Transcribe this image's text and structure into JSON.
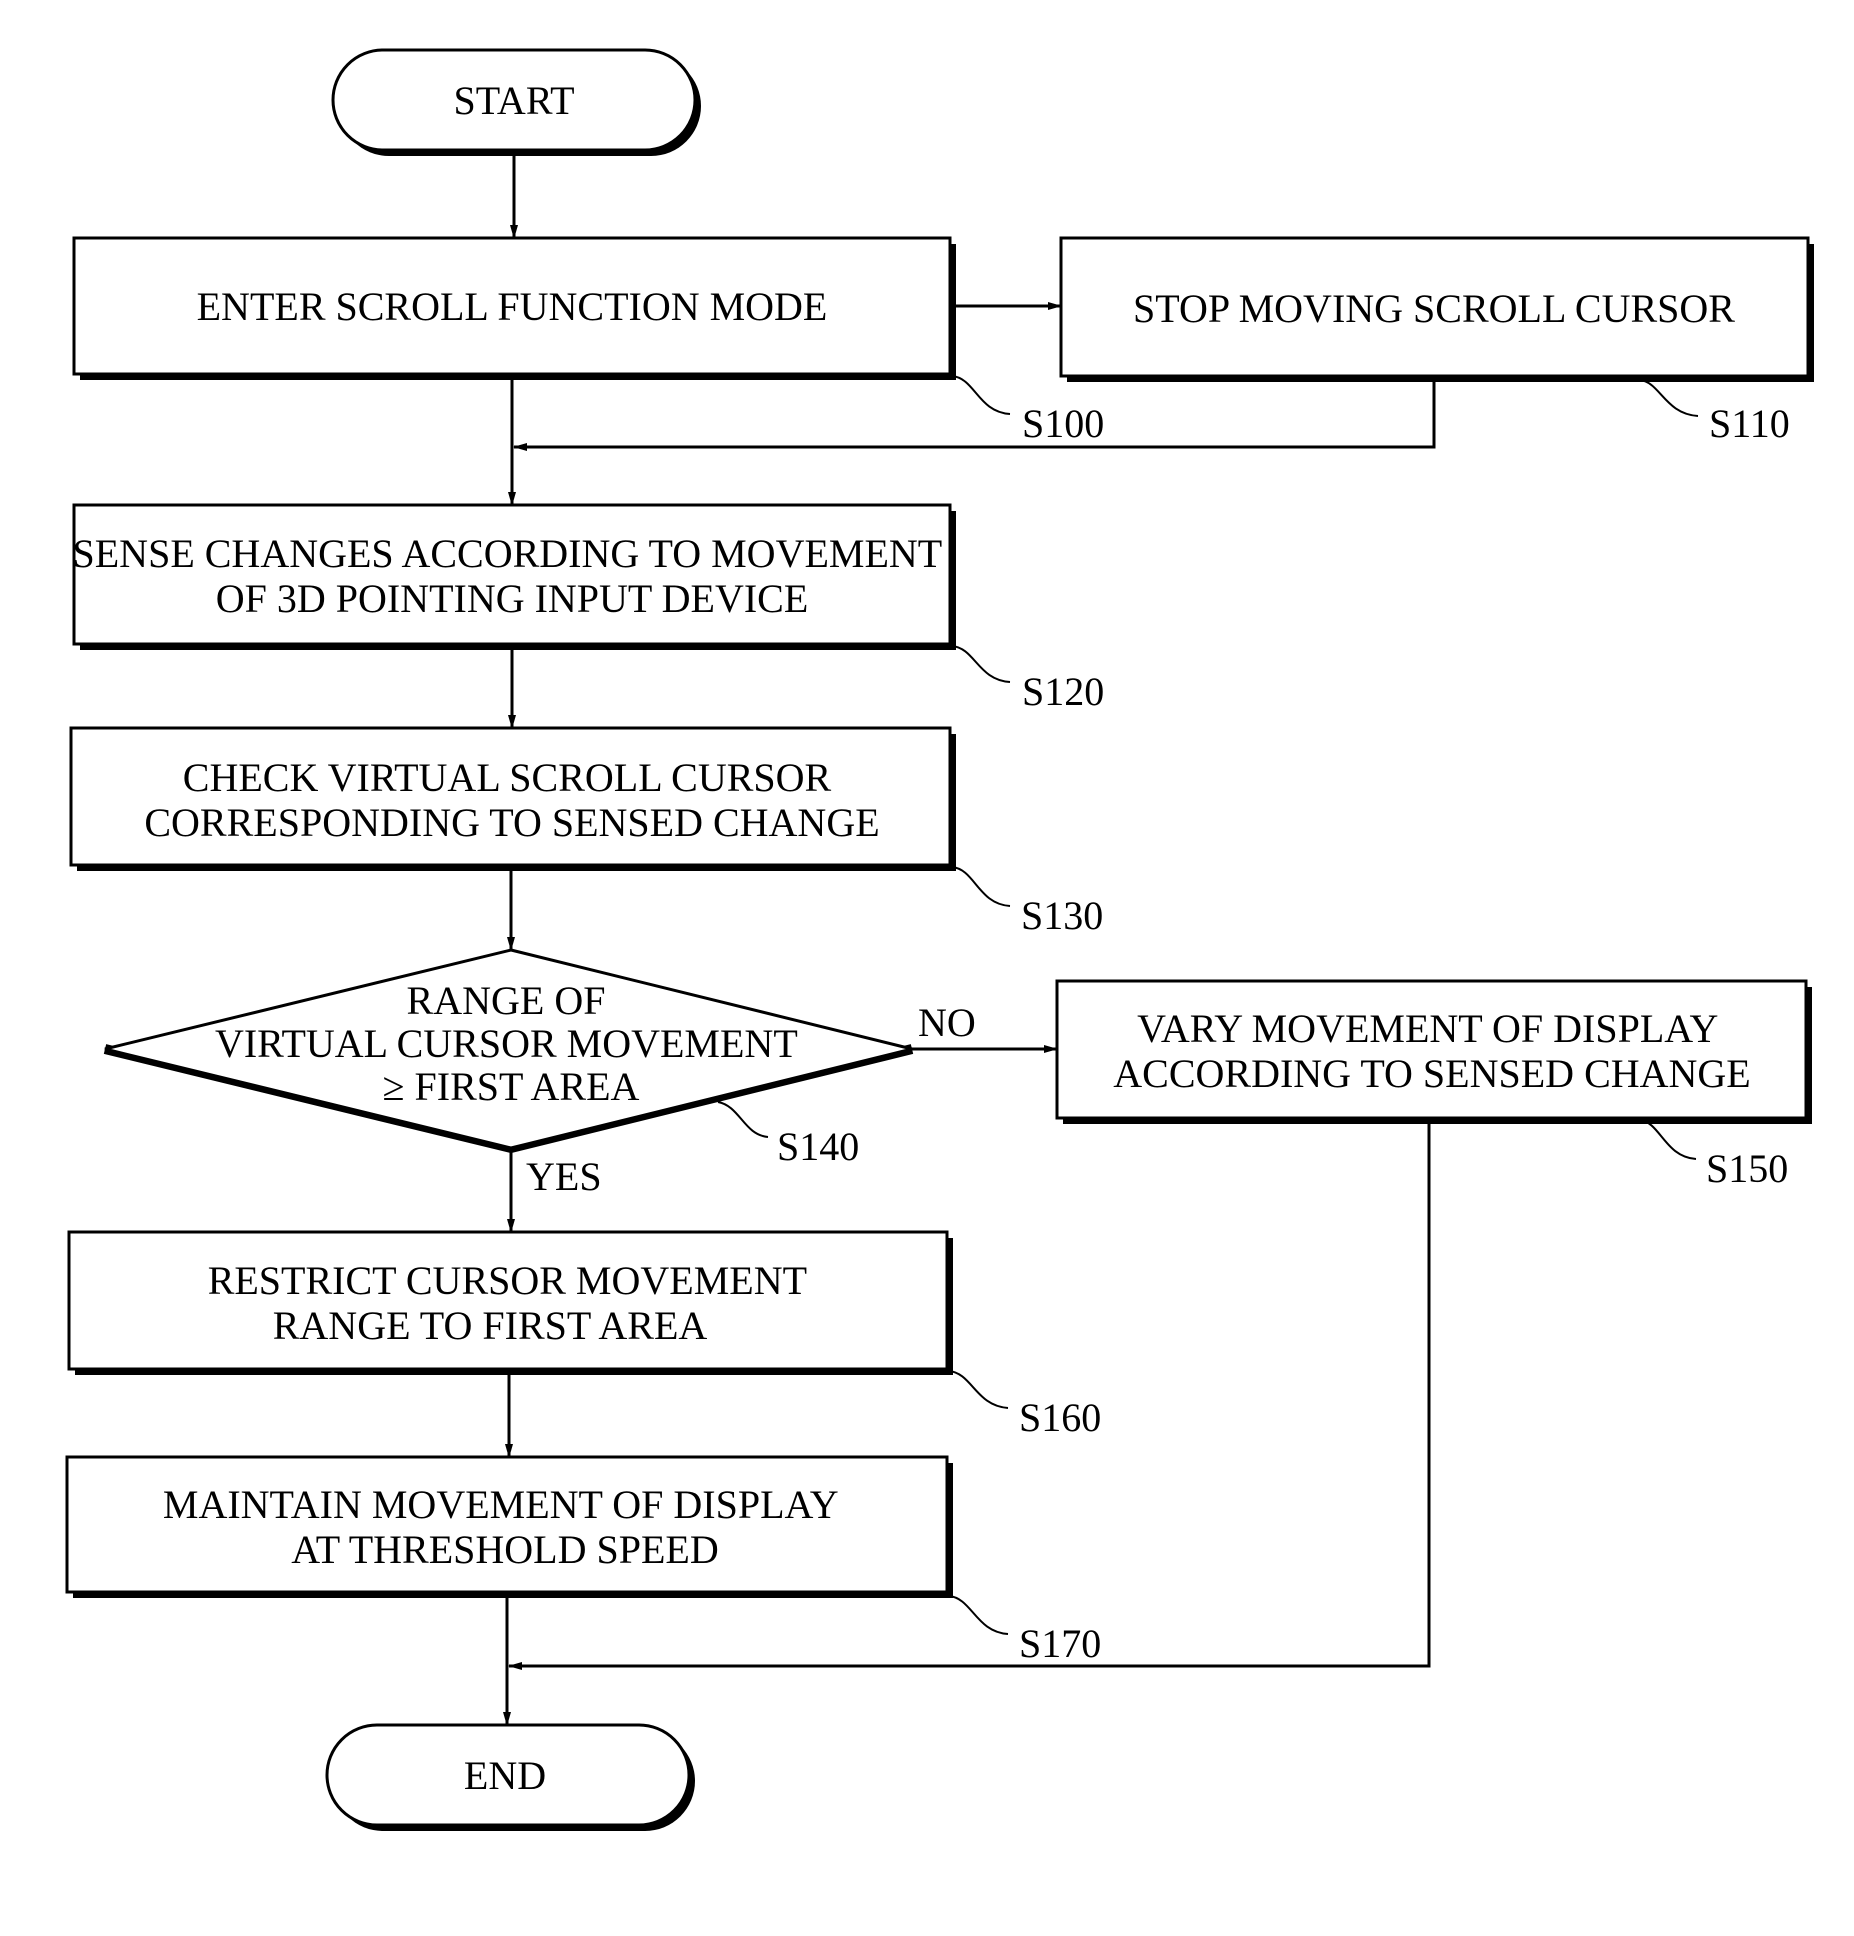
{
  "diagram": {
    "type": "flowchart",
    "nodes": {
      "start": {
        "text": "START"
      },
      "s100": {
        "lines": [
          "ENTER SCROLL FUNCTION MODE"
        ],
        "tag": "S100"
      },
      "s110": {
        "lines": [
          "STOP MOVING SCROLL CURSOR"
        ],
        "tag": "S110"
      },
      "s120": {
        "lines": [
          "SENSE CHANGES ACCORDING TO MOVEMENT",
          "OF 3D POINTING INPUT DEVICE"
        ],
        "tag": "S120"
      },
      "s130": {
        "lines": [
          "CHECK VIRTUAL SCROLL CURSOR",
          "CORRESPONDING TO SENSED CHANGE"
        ],
        "tag": "S130"
      },
      "s140": {
        "lines": [
          "RANGE OF",
          "VIRTUAL CURSOR MOVEMENT",
          "≥ FIRST AREA"
        ],
        "tag": "S140"
      },
      "s150": {
        "lines": [
          "VARY MOVEMENT OF DISPLAY",
          "ACCORDING TO SENSED CHANGE"
        ],
        "tag": "S150"
      },
      "s160": {
        "lines": [
          "RESTRICT CURSOR MOVEMENT",
          "RANGE TO FIRST AREA"
        ],
        "tag": "S160"
      },
      "s170": {
        "lines": [
          "MAINTAIN MOVEMENT OF DISPLAY",
          "AT THRESHOLD SPEED"
        ],
        "tag": "S170"
      },
      "end": {
        "text": "END"
      }
    },
    "branch_labels": {
      "no": "NO",
      "yes": "YES"
    }
  }
}
